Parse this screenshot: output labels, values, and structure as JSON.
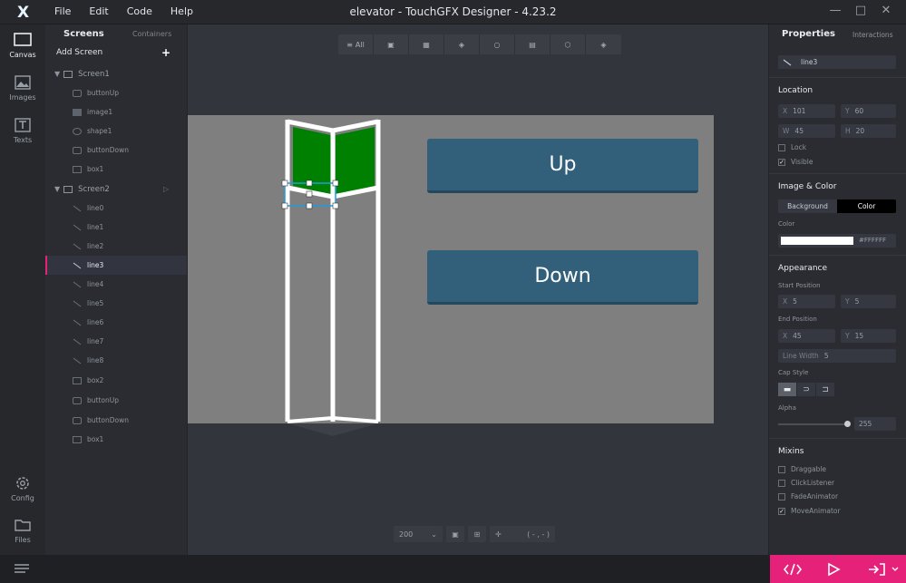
{
  "app": {
    "logo": "X",
    "title": "elevator - TouchGFX Designer - 4.23.2",
    "menu": [
      "File",
      "Edit",
      "Code",
      "Help"
    ]
  },
  "rail": [
    {
      "label": "Canvas",
      "icon": "canvas-icon"
    },
    {
      "label": "Images",
      "icon": "image-icon"
    },
    {
      "label": "Texts",
      "icon": "text-icon"
    },
    {
      "label": "Config",
      "icon": "gear-icon"
    },
    {
      "label": "Files",
      "icon": "folder-icon"
    }
  ],
  "tree": {
    "tab_screens": "Screens",
    "tab_containers": "Containers",
    "add_screen": "Add Screen",
    "screen1": {
      "name": "Screen1",
      "items": [
        "buttonUp",
        "image1",
        "shape1",
        "buttonDown",
        "box1"
      ]
    },
    "screen2": {
      "name": "Screen2",
      "items": [
        "line0",
        "line1",
        "line2",
        "line3",
        "line4",
        "line5",
        "line6",
        "line7",
        "line8",
        "box2",
        "buttonUp",
        "buttonDown",
        "box1"
      ]
    },
    "selected": "line3"
  },
  "canvas": {
    "toolbar_all": "All",
    "up_label": "Up",
    "down_label": "Down",
    "zoom": "200",
    "coord": "( - , - )"
  },
  "props": {
    "tab_properties": "Properties",
    "tab_interactions": "Interactions",
    "name": "line3",
    "location": {
      "header": "Location",
      "x_label": "X",
      "x": "101",
      "y_label": "Y",
      "y": "60",
      "w_label": "W",
      "w": "45",
      "h_label": "H",
      "h": "20",
      "lock": "Lock",
      "visible": "Visible"
    },
    "image_color": {
      "header": "Image & Color",
      "background": "Background",
      "color": "Color",
      "color_label": "Color",
      "color_value": "#FFFFFF"
    },
    "appearance": {
      "header": "Appearance",
      "start_label": "Start Position",
      "start_x": "5",
      "start_y": "5",
      "end_label": "End Position",
      "end_x": "45",
      "end_y": "15",
      "line_width_label": "Line Width",
      "line_width": "5",
      "cap_style": "Cap Style",
      "alpha_label": "Alpha",
      "alpha": "255"
    },
    "mixins": {
      "header": "Mixins",
      "draggable": "Draggable",
      "click": "ClickListener",
      "fade": "FadeAnimator",
      "move": "MoveAnimator"
    }
  },
  "colors": {
    "accent": "#e5217a",
    "button": "#325f7a",
    "green": "#008000",
    "selection": "#1e9be0"
  }
}
